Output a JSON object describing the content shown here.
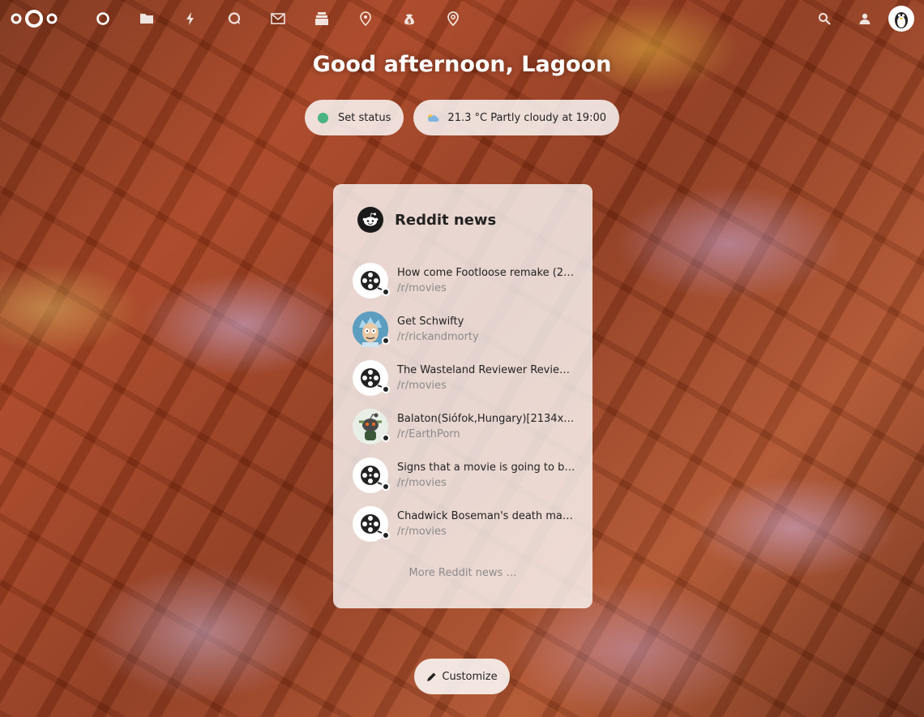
{
  "header": {
    "logo": "nextcloud-logo",
    "apps": [
      {
        "name": "dashboard-icon",
        "label": "Dashboard"
      },
      {
        "name": "files-icon",
        "label": "Files"
      },
      {
        "name": "activity-icon",
        "label": "Activity"
      },
      {
        "name": "talk-icon",
        "label": "Talk"
      },
      {
        "name": "mail-icon",
        "label": "Mail"
      },
      {
        "name": "deck-icon",
        "label": "Deck"
      },
      {
        "name": "maps-pin-icon",
        "label": "Maps"
      },
      {
        "name": "cospend-icon",
        "label": "Cospend"
      },
      {
        "name": "location-icon",
        "label": "Location"
      }
    ],
    "right": [
      "search-icon",
      "contacts-icon",
      "avatar"
    ]
  },
  "greeting": "Good afternoon, Lagoon",
  "status": {
    "set_status_label": "Set status",
    "weather_label": "21.3 °C Partly cloudy at 19:00",
    "status_color": "#49b382"
  },
  "widget": {
    "title": "Reddit news",
    "items": [
      {
        "title": "How come Footloose remake (2…",
        "sub": "/r/movies",
        "thumb": "film-reel-icon"
      },
      {
        "title": "Get Schwifty",
        "sub": "/r/rickandmorty",
        "thumb": "rick-avatar"
      },
      {
        "title": "The Wasteland Reviewer Revie…",
        "sub": "/r/movies",
        "thumb": "film-reel-icon"
      },
      {
        "title": "Balaton(Siófok,Hungary)[2134x…",
        "sub": "/r/EarthPorn",
        "thumb": "reddit-snoo-avatar"
      },
      {
        "title": "Signs that a movie is going to b…",
        "sub": "/r/movies",
        "thumb": "film-reel-icon"
      },
      {
        "title": "Chadwick Boseman's death mak…",
        "sub": "/r/movies",
        "thumb": "film-reel-icon"
      }
    ],
    "more_label": "More Reddit news …"
  },
  "customize_label": "Customize"
}
